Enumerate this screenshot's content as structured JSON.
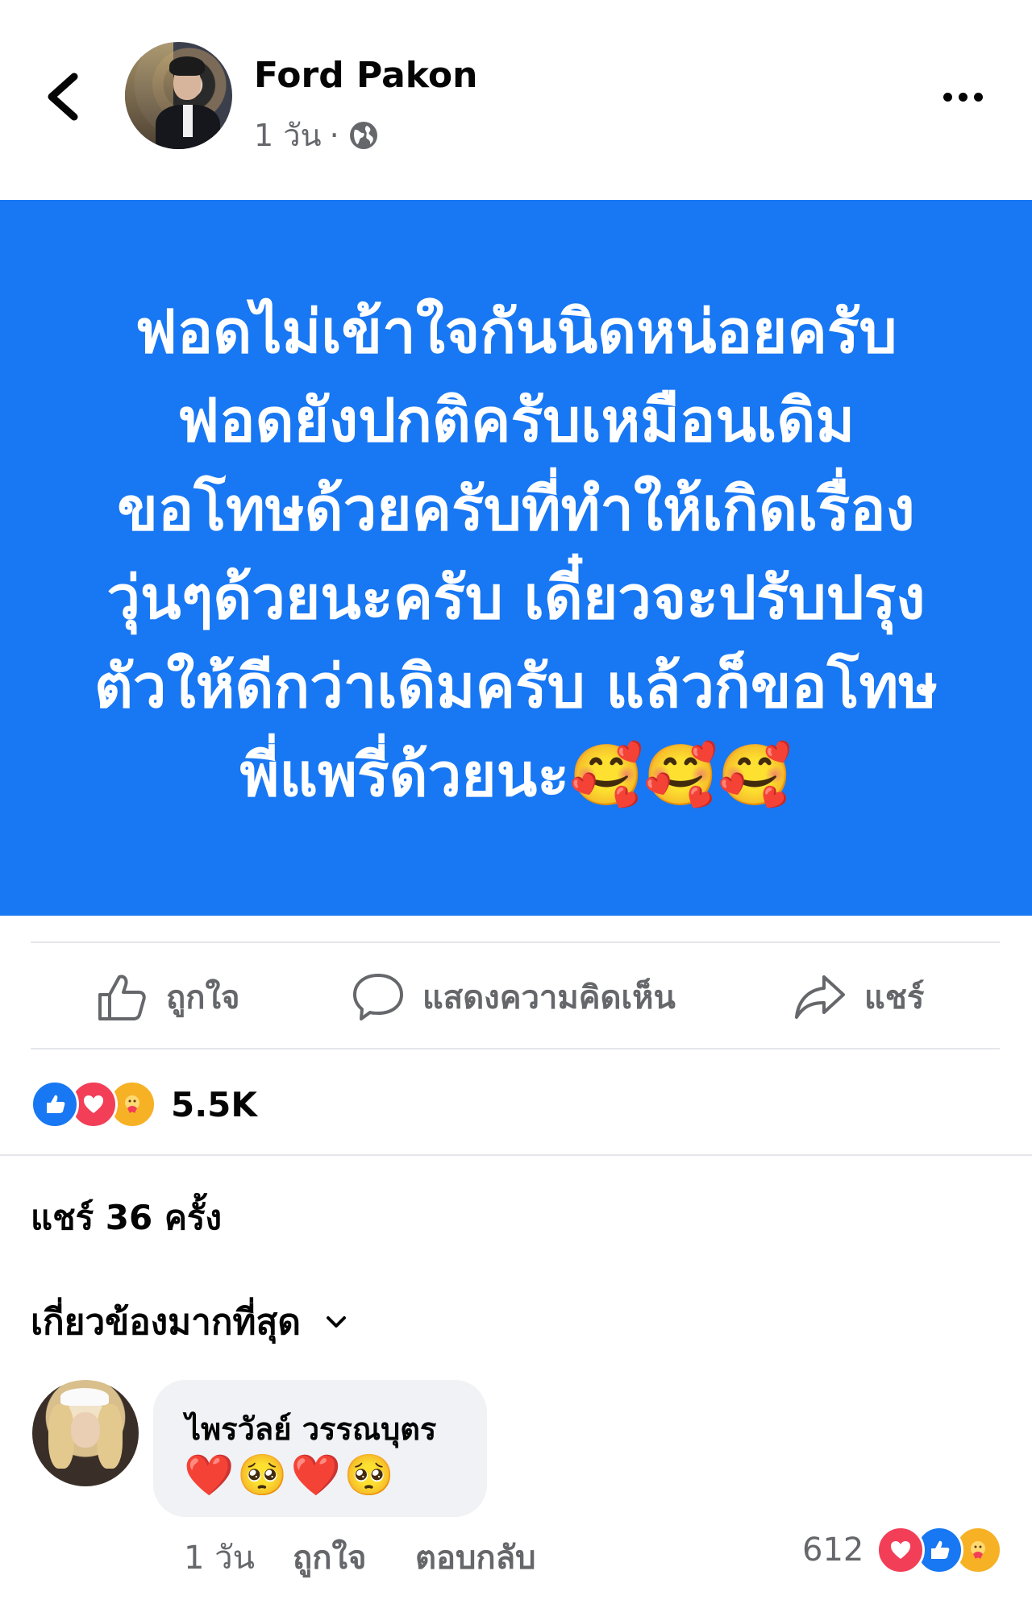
{
  "header": {
    "author": "Ford Pakon",
    "time": "1 วัน",
    "separator": "·"
  },
  "post": {
    "text": "ฟอดไม่เข้าใจกันนิดหน่อยครับ\nฟอดยังปกติครับเหมือนเดิม\nขอโทษด้วยครับที่ทำให้เกิดเรื่อง\nวุ่นๆด้วยนะครับ  เดี๋ยวจะปรับปรุง\nตัวให้ดีกว่าเดิมครับ แล้วก็ขอโทษ\nพี่แพรี่ด้วยนะ🥰🥰🥰",
    "background_color": "#1877f2"
  },
  "actions": {
    "like_label": "ถูกใจ",
    "comment_label": "แสดงความคิดเห็น",
    "share_label": "แชร์"
  },
  "reactions": {
    "count": "5.5K",
    "icons": [
      "like-icon",
      "love-icon",
      "care-icon"
    ]
  },
  "shares": {
    "text": "แชร์ 36 ครั้ง"
  },
  "sort": {
    "label": "เกี่ยวข้องมากที่สุด"
  },
  "comment": {
    "name": "ไพรวัลย์ วรรณบุตร",
    "text": "❤️🥺❤️🥺",
    "time": "1 วัน",
    "like_label": "ถูกใจ",
    "reply_label": "ตอบกลับ",
    "reaction_count": "612",
    "reaction_icons": [
      "love-icon",
      "like-icon",
      "care-icon"
    ]
  }
}
